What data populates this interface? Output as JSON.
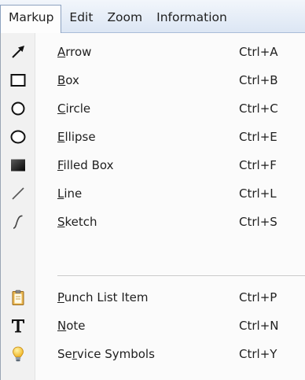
{
  "menubar": {
    "items": [
      {
        "label": "Markup"
      },
      {
        "label": "Edit"
      },
      {
        "label": "Zoom"
      },
      {
        "label": "Information"
      }
    ]
  },
  "menu": {
    "items": [
      {
        "key": "A",
        "rest": "rrow",
        "pre": "",
        "shortcut": "Ctrl+A",
        "icon": "arrow-icon"
      },
      {
        "key": "B",
        "rest": "ox",
        "pre": "",
        "shortcut": "Ctrl+B",
        "icon": "box-icon"
      },
      {
        "key": "C",
        "rest": "ircle",
        "pre": "",
        "shortcut": "Ctrl+C",
        "icon": "circle-icon"
      },
      {
        "key": "E",
        "rest": "llipse",
        "pre": "",
        "shortcut": "Ctrl+E",
        "icon": "ellipse-icon"
      },
      {
        "key": "F",
        "rest": "illed Box",
        "pre": "",
        "shortcut": "Ctrl+F",
        "icon": "filled-box-icon"
      },
      {
        "key": "L",
        "rest": "ine",
        "pre": "",
        "shortcut": "Ctrl+L",
        "icon": "line-icon"
      },
      {
        "key": "S",
        "rest": "ketch",
        "pre": "",
        "shortcut": "Ctrl+S",
        "icon": "sketch-icon"
      },
      {
        "key": "P",
        "rest": "unch List Item",
        "pre": "",
        "shortcut": "Ctrl+P",
        "icon": "clipboard-icon"
      },
      {
        "key": "N",
        "rest": "ote",
        "pre": "",
        "shortcut": "Ctrl+N",
        "icon": "text-t-icon"
      },
      {
        "key": "r",
        "rest": "vice Symbols",
        "pre": "Se",
        "shortcut": "Ctrl+Y",
        "icon": "lightbulb-icon"
      }
    ]
  }
}
